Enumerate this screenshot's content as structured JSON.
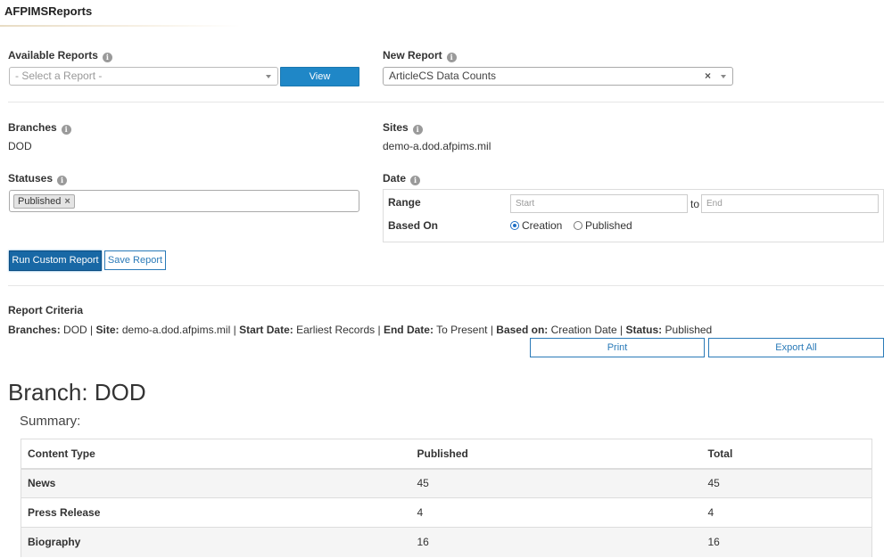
{
  "app": {
    "title": "AFPIMSReports"
  },
  "available_reports": {
    "label": "Available Reports",
    "select_placeholder": "- Select a Report -",
    "view_button": "View"
  },
  "new_report": {
    "label": "New Report",
    "selected": "ArticleCS Data Counts"
  },
  "branches": {
    "label": "Branches",
    "value": "DOD"
  },
  "sites": {
    "label": "Sites",
    "value": "demo-a.dod.afpims.mil"
  },
  "statuses": {
    "label": "Statuses",
    "tags": [
      "Published"
    ]
  },
  "date": {
    "label": "Date",
    "range_label": "Range",
    "start_placeholder": "Start",
    "to": "to",
    "end_placeholder": "End",
    "based_on_label": "Based On",
    "options": [
      "Creation",
      "Published"
    ],
    "selected": "Creation"
  },
  "actions": {
    "run": "Run Custom Report",
    "save": "Save Report"
  },
  "criteria": {
    "title": "Report Criteria",
    "items": [
      {
        "key": "Branches:",
        "value": "DOD"
      },
      {
        "key": "Site:",
        "value": "demo-a.dod.afpims.mil"
      },
      {
        "key": "Start Date:",
        "value": "Earliest Records"
      },
      {
        "key": "End Date:",
        "value": "To Present"
      },
      {
        "key": "Based on:",
        "value": "Creation Date"
      },
      {
        "key": "Status:",
        "value": "Published"
      }
    ],
    "separator": "|"
  },
  "report_buttons": {
    "print": "Print",
    "export": "Export All"
  },
  "branch": {
    "title": "Branch: DOD",
    "summary_label": "Summary:"
  },
  "table": {
    "headers": [
      "Content Type",
      "Published",
      "Total"
    ],
    "rows": [
      [
        "News",
        "45",
        "45"
      ],
      [
        "Press Release",
        "4",
        "4"
      ],
      [
        "Biography",
        "16",
        "16"
      ]
    ]
  },
  "colors": {
    "primary": "#1f87c7",
    "run_button": "#1868a5",
    "outline": "#2a7ab8"
  },
  "icons": {
    "info": "info-icon",
    "caret": "chevron-down-icon",
    "clear": "close-icon"
  }
}
